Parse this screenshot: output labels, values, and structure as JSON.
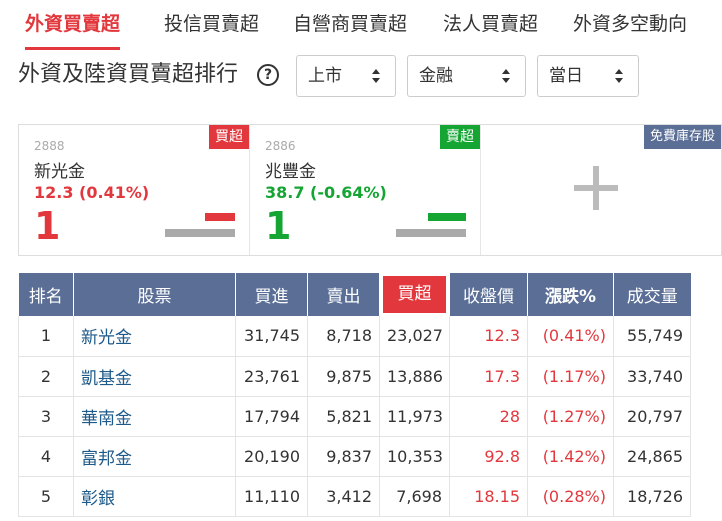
{
  "tabs": [
    {
      "label": "外資買賣超",
      "active": true
    },
    {
      "label": "投信買賣超",
      "active": false
    },
    {
      "label": "自營商買賣超",
      "active": false
    },
    {
      "label": "法人買賣超",
      "active": false
    },
    {
      "label": "外資多空動向",
      "active": false
    }
  ],
  "title": "外資及陸資買賣超排行",
  "help_icon": "?",
  "filters": {
    "market": "上市",
    "industry": "金融",
    "period": "當日"
  },
  "cards": [
    {
      "code": "2888",
      "name": "新光金",
      "price_change": "12.3 (0.41%)",
      "rank": "1",
      "badge": "買超",
      "direction": "up"
    },
    {
      "code": "2886",
      "name": "兆豐金",
      "price_change": "38.7 (-0.64%)",
      "rank": "1",
      "badge": "賣超",
      "direction": "down"
    }
  ],
  "free_stock_badge": "免費庫存股",
  "table": {
    "headers": [
      "排名",
      "股票",
      "買進",
      "賣出",
      "買超",
      "收盤價",
      "漲跌%",
      "成交量"
    ],
    "rows": [
      {
        "rank": "1",
        "stock": "新光金",
        "buy": "31,745",
        "sell": "8,718",
        "net": "23,027",
        "close": "12.3",
        "change": "(0.41%)",
        "volume": "55,749"
      },
      {
        "rank": "2",
        "stock": "凱基金",
        "buy": "23,761",
        "sell": "9,875",
        "net": "13,886",
        "close": "17.3",
        "change": "(1.17%)",
        "volume": "33,740"
      },
      {
        "rank": "3",
        "stock": "華南金",
        "buy": "17,794",
        "sell": "5,821",
        "net": "11,973",
        "close": "28",
        "change": "(1.27%)",
        "volume": "20,797"
      },
      {
        "rank": "4",
        "stock": "富邦金",
        "buy": "20,190",
        "sell": "9,837",
        "net": "10,353",
        "close": "92.8",
        "change": "(1.42%)",
        "volume": "24,865"
      },
      {
        "rank": "5",
        "stock": "彰銀",
        "buy": "11,110",
        "sell": "3,412",
        "net": "7,698",
        "close": "18.15",
        "change": "(0.28%)",
        "volume": "18,726"
      }
    ]
  },
  "colors": {
    "accent_red": "#e2383d",
    "green": "#14a533",
    "header_bg": "#5a6e96",
    "stock_link": "#1e5a8a"
  }
}
